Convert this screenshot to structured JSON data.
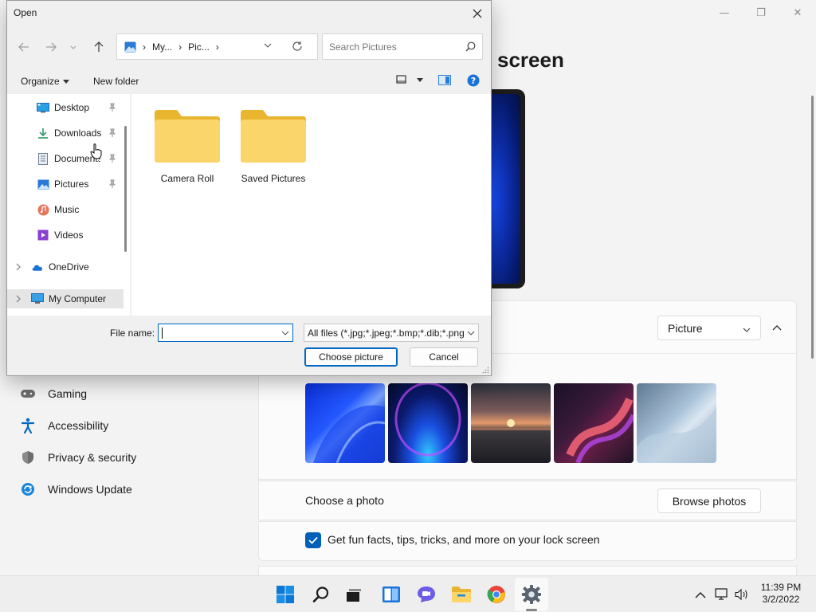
{
  "settings": {
    "page_title": "screen",
    "nav": [
      {
        "label": "Gaming",
        "icon": "gaming-icon"
      },
      {
        "label": "Accessibility",
        "icon": "accessibility-icon"
      },
      {
        "label": "Privacy & security",
        "icon": "shield-icon"
      },
      {
        "label": "Windows Update",
        "icon": "windows-update-icon"
      }
    ],
    "personalize_select": "Picture",
    "choose_photo_label": "Choose a photo",
    "browse_button": "Browse photos",
    "fun_facts_label": "Get fun facts, tips, tricks, and more on your lock screen",
    "fun_facts_checked": true,
    "accent_color": "#005fb8"
  },
  "dialog": {
    "title": "Open",
    "breadcrumb": [
      "My...",
      "Pic..."
    ],
    "search_placeholder": "Search Pictures",
    "toolbar": {
      "organize": "Organize",
      "new_folder": "New folder"
    },
    "nav_items": [
      {
        "label": "Desktop",
        "icon": "desktop-icon",
        "pinned": true
      },
      {
        "label": "Downloads",
        "icon": "download-icon",
        "pinned": true
      },
      {
        "label": "Documents",
        "icon": "documents-icon",
        "pinned": true
      },
      {
        "label": "Pictures",
        "icon": "pictures-icon",
        "pinned": true
      },
      {
        "label": "Music",
        "icon": "music-icon",
        "pinned": false
      },
      {
        "label": "Videos",
        "icon": "videos-icon",
        "pinned": false
      },
      {
        "label": "OneDrive",
        "icon": "onedrive-icon",
        "pinned": false
      },
      {
        "label": "My Computer",
        "icon": "computer-icon",
        "pinned": false
      }
    ],
    "folders": [
      {
        "label": "Camera Roll"
      },
      {
        "label": "Saved Pictures"
      }
    ],
    "file_name_label": "File name:",
    "file_name_value": "",
    "file_type": "All files (*.jpg;*.jpeg;*.bmp;*.dib;*.png",
    "choose_button": "Choose picture",
    "cancel_button": "Cancel"
  },
  "taskbar": {
    "apps": [
      "start-icon",
      "search-icon",
      "task-view-icon",
      "widgets-icon",
      "chat-icon",
      "file-explorer-icon",
      "chrome-icon",
      "settings-icon"
    ],
    "time": "11:39 PM",
    "date": "3/2/2022"
  }
}
